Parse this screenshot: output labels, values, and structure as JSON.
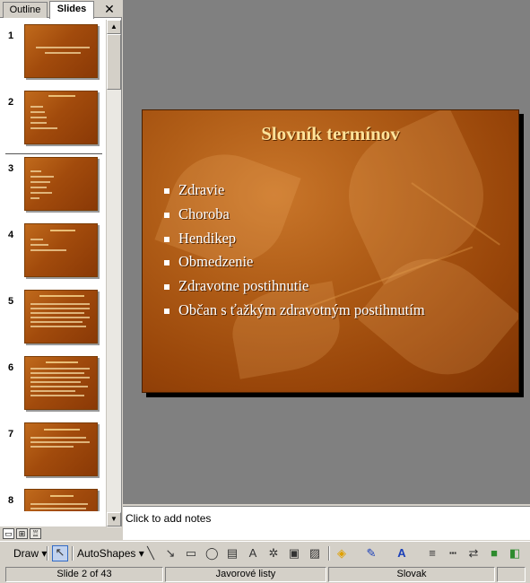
{
  "tabs": {
    "outline": "Outline",
    "slides": "Slides",
    "close": "✕"
  },
  "thumbnails": [
    {
      "num": "1"
    },
    {
      "num": "2"
    },
    {
      "num": "3"
    },
    {
      "num": "4"
    },
    {
      "num": "5"
    },
    {
      "num": "6"
    },
    {
      "num": "7"
    },
    {
      "num": "8"
    }
  ],
  "slide": {
    "title": "Slovník termínov",
    "bullets": [
      "Zdravie",
      "Choroba",
      "Hendikep",
      "Obmedzenie",
      "Zdravotne postihnutie",
      "Občan s ťažkým zdravotným postihnutím"
    ]
  },
  "notes": {
    "placeholder": "Click to add notes"
  },
  "drawing_toolbar": {
    "draw": "Draw",
    "autoshapes": "AutoShapes"
  },
  "status": {
    "slide": "Slide 2 of 43",
    "design": "Javorové listy",
    "language": "Slovak"
  },
  "colors": {
    "slide_bg": "#a24b0c",
    "title": "#ffe39a",
    "canvas": "#808080"
  }
}
